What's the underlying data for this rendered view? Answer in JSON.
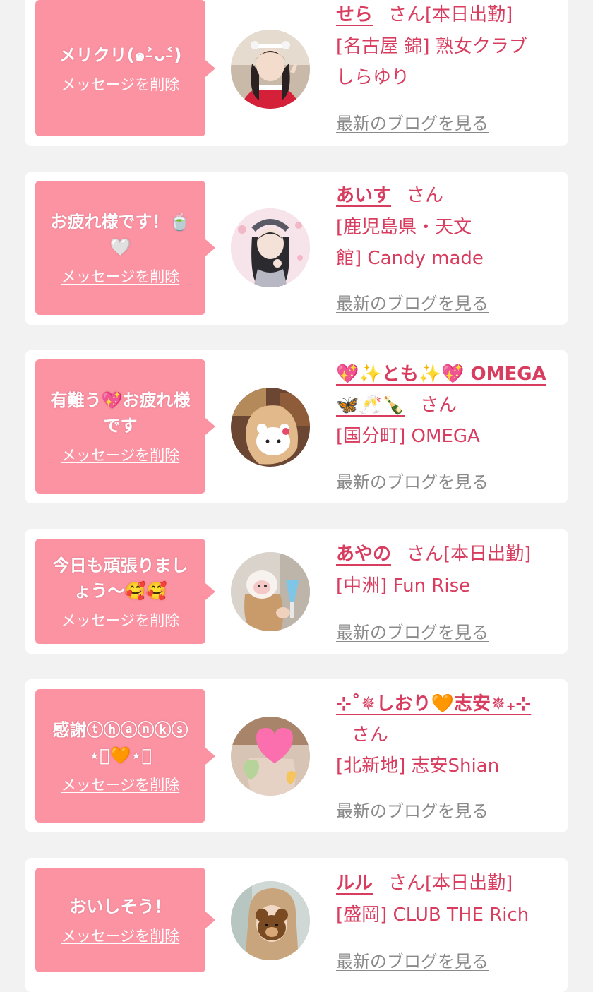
{
  "colors": {
    "bubble": "#fb93a3",
    "accent": "#d83c5e",
    "link_gray": "#8a8a8a",
    "background": "#f2f2f2"
  },
  "delete_label": "メッセージを削除",
  "blog_label": "最新のブログを見る",
  "san_suffix": "さん",
  "cards": [
    {
      "message_lines": [
        "メリクリ(๑˃̵ᴗ˂̵)"
      ],
      "name": "せら",
      "status": "[本日出勤]",
      "shop_lines": [
        "[名古屋 錦] 熟女クラブ",
        "しらゆり"
      ],
      "avatar": "avatar-santa-costume"
    },
    {
      "message_lines": [
        "お疲れ様です！🍵",
        "🤍"
      ],
      "name": "あいす",
      "status": "",
      "shop_lines": [
        "[鹿児島県・天文",
        "館] Candy made"
      ],
      "avatar": "avatar-lace-headband"
    },
    {
      "message_lines": [
        "有難う💖お疲れ様",
        "です"
      ],
      "name": "💖✨とも✨💖 OMEGA🦋🥂🍾",
      "status": "",
      "shop_lines": [
        "[国分町] OMEGA"
      ],
      "avatar": "avatar-hello-kitty-sticker"
    },
    {
      "message_lines": [
        "今日も頑張りまし",
        "ょう〜🥰🥰"
      ],
      "name": "あやの",
      "status": "[本日出勤]",
      "shop_lines": [
        "[中洲] Fun Rise"
      ],
      "avatar": "avatar-sheep-sticker"
    },
    {
      "message_lines": [
        "感謝ⓣⓗⓐⓝⓚⓢ",
        "⋆͛🧡⋆͛"
      ],
      "name": "⊹˚✵しおり🧡志安✵₊⊹",
      "status": "",
      "shop_lines": [
        "[北新地] 志安Shian"
      ],
      "avatar": "avatar-heart-sticker"
    },
    {
      "message_lines": [
        "おいしそう！"
      ],
      "name": "ルル",
      "status": "[本日出勤]",
      "shop_lines": [
        "[盛岡] CLUB THE Rich"
      ],
      "avatar": "avatar-bear-sticker"
    }
  ]
}
